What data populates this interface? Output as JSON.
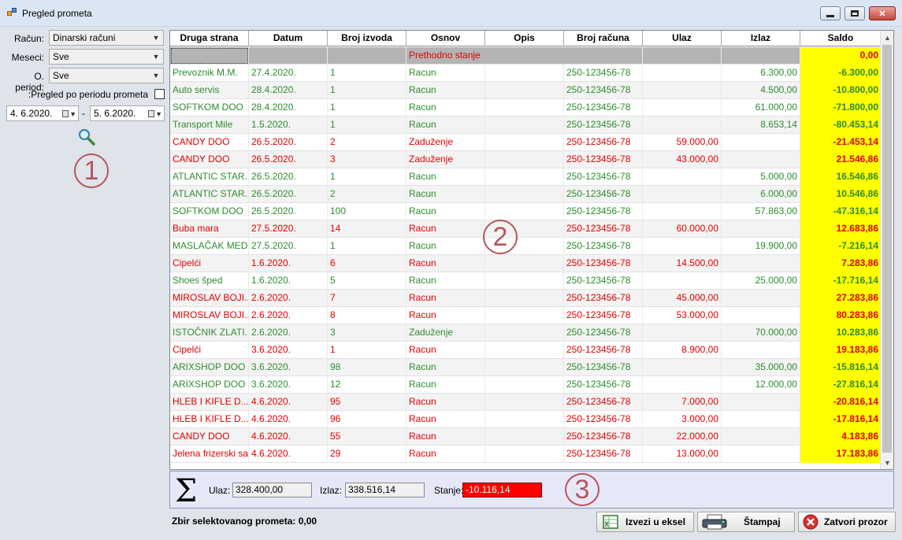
{
  "window": {
    "title": "Pregled prometa"
  },
  "filters": {
    "racun_label": "Račun:",
    "racun_value": "Dinarski računi",
    "meseci_label": "Meseci:",
    "meseci_value": "Sve",
    "period_label": "O. period:",
    "period_value": "Sve",
    "pregled_label": ":Pregled po periodu prometa",
    "pregled_checked": false,
    "date_from": "4.  6.2020.",
    "date_sep": "-",
    "date_to": "5.  6.2020."
  },
  "callouts": {
    "one": "1",
    "two": "2",
    "three": "3"
  },
  "grid": {
    "columns": [
      "Druga strana",
      "Datum",
      "Broj izvoda",
      "Osnov",
      "Opis",
      "Broj računa",
      "Ulaz",
      "Izlaz",
      "Saldo"
    ],
    "prev_row": {
      "osnov": "Prethodno stanje",
      "saldo": "0,00"
    },
    "rows": [
      {
        "strana": "Prevoznik M.M.",
        "datum": "27.4.2020.",
        "izvod": "1",
        "osnov": "Racun",
        "opis": "",
        "racun": "250-123456-78",
        "ulaz": "",
        "izlaz": "6.300,00",
        "saldo": "-6.300,00",
        "color": "green"
      },
      {
        "strana": "Auto servis",
        "datum": "28.4.2020.",
        "izvod": "1",
        "osnov": "Racun",
        "opis": "",
        "racun": "250-123456-78",
        "ulaz": "",
        "izlaz": "4.500,00",
        "saldo": "-10.800,00",
        "color": "green"
      },
      {
        "strana": "SOFTKOM DOO",
        "datum": "28.4.2020.",
        "izvod": "1",
        "osnov": "Racun",
        "opis": "",
        "racun": "250-123456-78",
        "ulaz": "",
        "izlaz": "61.000,00",
        "saldo": "-71.800,00",
        "color": "green"
      },
      {
        "strana": "Transport Mile",
        "datum": "1.5.2020.",
        "izvod": "1",
        "osnov": "Racun",
        "opis": "",
        "racun": "250-123456-78",
        "ulaz": "",
        "izlaz": "8.653,14",
        "saldo": "-80.453,14",
        "color": "green"
      },
      {
        "strana": "CANDY DOO",
        "datum": "26.5.2020.",
        "izvod": "2",
        "osnov": "Zaduženje",
        "opis": "",
        "racun": "250-123456-78",
        "ulaz": "59.000,00",
        "izlaz": "",
        "saldo": "-21.453,14",
        "color": "red"
      },
      {
        "strana": "CANDY DOO",
        "datum": "26.5.2020.",
        "izvod": "3",
        "osnov": "Zaduženje",
        "opis": "",
        "racun": "250-123456-78",
        "ulaz": "43.000,00",
        "izlaz": "",
        "saldo": "21.546,86",
        "color": "red"
      },
      {
        "strana": "ATLANTIC STAR...",
        "datum": "26.5.2020.",
        "izvod": "1",
        "osnov": "Racun",
        "opis": "",
        "racun": "250-123456-78",
        "ulaz": "",
        "izlaz": "5.000,00",
        "saldo": "16.546,86",
        "color": "green"
      },
      {
        "strana": "ATLANTIC STAR...",
        "datum": "26.5.2020.",
        "izvod": "2",
        "osnov": "Racun",
        "opis": "",
        "racun": "250-123456-78",
        "ulaz": "",
        "izlaz": "6.000,00",
        "saldo": "10.546,86",
        "color": "green"
      },
      {
        "strana": "SOFTKOM DOO",
        "datum": "26.5.2020.",
        "izvod": "100",
        "osnov": "Racun",
        "opis": "",
        "racun": "250-123456-78",
        "ulaz": "",
        "izlaz": "57.863,00",
        "saldo": "-47.316,14",
        "color": "green"
      },
      {
        "strana": "Buba mara",
        "datum": "27.5.2020.",
        "izvod": "14",
        "osnov": "Racun",
        "opis": "",
        "racun": "250-123456-78",
        "ulaz": "60.000,00",
        "izlaz": "",
        "saldo": "12.683,86",
        "color": "red"
      },
      {
        "strana": "MASLAČAK MED...",
        "datum": "27.5.2020.",
        "izvod": "1",
        "osnov": "Racun",
        "opis": "",
        "racun": "250-123456-78",
        "ulaz": "",
        "izlaz": "19.900,00",
        "saldo": "-7.216,14",
        "color": "green"
      },
      {
        "strana": "Cipelći",
        "datum": "1.6.2020.",
        "izvod": "6",
        "osnov": "Racun",
        "opis": "",
        "racun": "250-123456-78",
        "ulaz": "14.500,00",
        "izlaz": "",
        "saldo": "7.283,86",
        "color": "red"
      },
      {
        "strana": "Shoes šped",
        "datum": "1.6.2020.",
        "izvod": "5",
        "osnov": "Racun",
        "opis": "",
        "racun": "250-123456-78",
        "ulaz": "",
        "izlaz": "25.000,00",
        "saldo": "-17.716,14",
        "color": "green"
      },
      {
        "strana": "MIROSLAV BOJI...",
        "datum": "2.6.2020.",
        "izvod": "7",
        "osnov": "Racun",
        "opis": "",
        "racun": "250-123456-78",
        "ulaz": "45.000,00",
        "izlaz": "",
        "saldo": "27.283,86",
        "color": "red"
      },
      {
        "strana": "MIROSLAV BOJI...",
        "datum": "2.6.2020.",
        "izvod": "8",
        "osnov": "Racun",
        "opis": "",
        "racun": "250-123456-78",
        "ulaz": "53.000,00",
        "izlaz": "",
        "saldo": "80.283,86",
        "color": "red"
      },
      {
        "strana": "ISTOČNIK ZLATI...",
        "datum": "2.6.2020.",
        "izvod": "3",
        "osnov": "Zaduženje",
        "opis": "",
        "racun": "250-123456-78",
        "ulaz": "",
        "izlaz": "70.000,00",
        "saldo": "10.283,86",
        "color": "green"
      },
      {
        "strana": "Cipelći",
        "datum": "3.6.2020.",
        "izvod": "1",
        "osnov": "Racun",
        "opis": "",
        "racun": "250-123456-78",
        "ulaz": "8.900,00",
        "izlaz": "",
        "saldo": "19.183,86",
        "color": "red"
      },
      {
        "strana": "ARIXSHOP DOO",
        "datum": "3.6.2020.",
        "izvod": "98",
        "osnov": "Racun",
        "opis": "",
        "racun": "250-123456-78",
        "ulaz": "",
        "izlaz": "35.000,00",
        "saldo": "-15.816,14",
        "color": "green"
      },
      {
        "strana": "ARIXSHOP DOO",
        "datum": "3.6.2020.",
        "izvod": "12",
        "osnov": "Racun",
        "opis": "",
        "racun": "250-123456-78",
        "ulaz": "",
        "izlaz": "12.000,00",
        "saldo": "-27.816,14",
        "color": "green"
      },
      {
        "strana": "HLEB I KIFLE  D...",
        "datum": "4.6.2020.",
        "izvod": "95",
        "osnov": "Racun",
        "opis": "",
        "racun": "250-123456-78",
        "ulaz": "7.000,00",
        "izlaz": "",
        "saldo": "-20.816,14",
        "color": "red"
      },
      {
        "strana": "HLEB I KIFLE  D...",
        "datum": "4.6.2020.",
        "izvod": "96",
        "osnov": "Racun",
        "opis": "",
        "racun": "250-123456-78",
        "ulaz": "3.000,00",
        "izlaz": "",
        "saldo": "-17.816,14",
        "color": "red"
      },
      {
        "strana": "CANDY DOO",
        "datum": "4.6.2020.",
        "izvod": "55",
        "osnov": "Racun",
        "opis": "",
        "racun": "250-123456-78",
        "ulaz": "22.000,00",
        "izlaz": "",
        "saldo": "4.183,86",
        "color": "red"
      },
      {
        "strana": "Jelena frizerski sa...",
        "datum": "4.6.2020.",
        "izvod": "29",
        "osnov": "Racun",
        "opis": "",
        "racun": "250-123456-78",
        "ulaz": "13.000,00",
        "izlaz": "",
        "saldo": "17.183,86",
        "color": "red"
      }
    ]
  },
  "totals": {
    "ulaz_label": "Ulaz:",
    "ulaz_value": "328.400,00",
    "izlaz_label": "Izlaz:",
    "izlaz_value": "338.516,14",
    "stanje_label": "Stanje:",
    "stanje_value": "-10.116,14"
  },
  "bottom": {
    "zbir_label": "Zbir selektovanog prometa:",
    "zbir_value": "0,00",
    "export_label": "Izvezi u eksel",
    "print_label": "Štampaj",
    "close_label": "Zatvori prozor"
  },
  "colors": {
    "green": "#2e8b2e",
    "red": "#e00000",
    "saldo_bg": "#ffff00",
    "stanje_bg": "#ff0000"
  }
}
